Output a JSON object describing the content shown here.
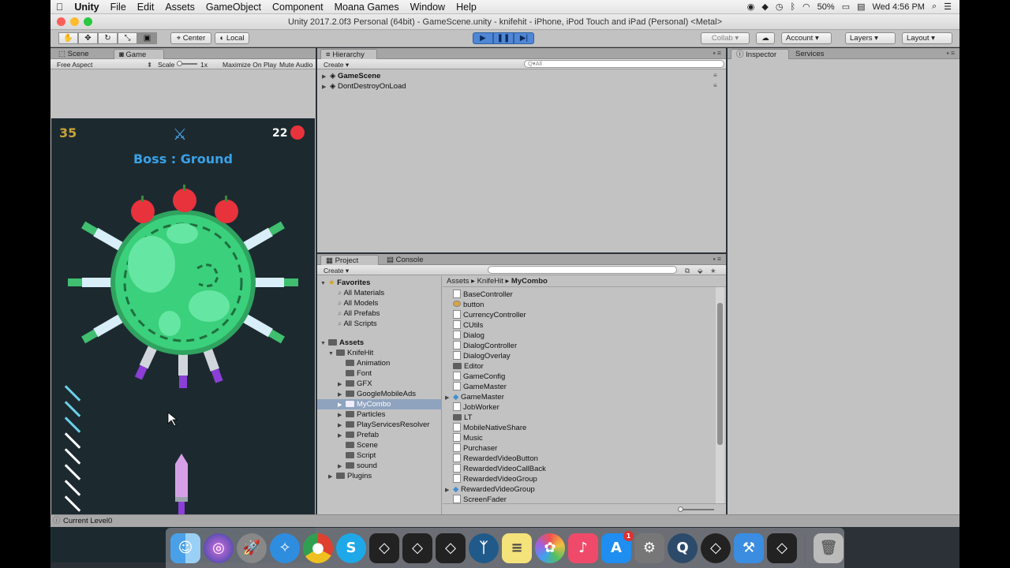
{
  "menubar": {
    "app": "Unity",
    "items": [
      "File",
      "Edit",
      "Assets",
      "GameObject",
      "Component",
      "Moana Games",
      "Window",
      "Help"
    ],
    "battery": "50%",
    "clock": "Wed 4:56 PM"
  },
  "window": {
    "title": "Unity 2017.2.0f3 Personal (64bit) - GameScene.unity - knifehit - iPhone, iPod Touch and iPad (Personal) <Metal>"
  },
  "toolbar": {
    "pivot_label": "Center",
    "space_label": "Local",
    "collab_label": "Collab ▾",
    "account_label": "Account",
    "layers_label": "Layers",
    "layout_label": "Layout"
  },
  "scene_game": {
    "tabs": [
      "Scene",
      "Game"
    ],
    "aspect": "Free Aspect",
    "scale_label": "Scale",
    "scale_value": "1x",
    "maximize_label": "Maximize On Play",
    "mute_label": "Mute Audio"
  },
  "game": {
    "score": "35",
    "apples": "22",
    "boss_title": "Boss : Ground",
    "remaining_knives": 8
  },
  "hierarchy": {
    "tab": "Hierarchy",
    "create_label": "Create",
    "search_placeholder": "Q▾All",
    "items": [
      "GameScene",
      "DontDestroyOnLoad"
    ]
  },
  "project": {
    "tabs": [
      "Project",
      "Console"
    ],
    "create_label": "Create",
    "favorites_label": "Favorites",
    "favorites": [
      "All Materials",
      "All Models",
      "All Prefabs",
      "All Scripts"
    ],
    "assets_label": "Assets",
    "knifehit_label": "KnifeHit",
    "folders": [
      "Animation",
      "Font",
      "GFX",
      "GoogleMobileAds",
      "MyCombo",
      "Particles",
      "PlayServicesResolver",
      "Prefab",
      "Scene",
      "Script",
      "sound"
    ],
    "plugins_label": "Plugins",
    "breadcrumb": [
      "Assets",
      "KnifeHit",
      "MyCombo"
    ],
    "files": [
      "BaseController",
      "button",
      "CurrencyController",
      "CUtils",
      "Dialog",
      "DialogController",
      "DialogOverlay",
      "Editor",
      "GameConfig",
      "GameMaster",
      "GameMaster",
      "JobWorker",
      "LT",
      "MobileNativeShare",
      "Music",
      "Purchaser",
      "RewardedVideoButton",
      "RewardedVideoCallBack",
      "RewardedVideoGroup",
      "RewardedVideoGroup",
      "ScreenFader"
    ]
  },
  "inspector": {
    "tabs": [
      "Inspector",
      "Services"
    ]
  },
  "status": {
    "message": "Current Level0"
  },
  "dock": {
    "apps": [
      "Finder",
      "Siri",
      "Launchpad",
      "Safari",
      "Chrome",
      "Skype",
      "Unity",
      "Unity",
      "Unity",
      "Sourcetree",
      "Notes",
      "Photos",
      "iTunes",
      "App Store",
      "System Preferences",
      "QuickTime",
      "Unity Hub",
      "Xcode",
      "Unity",
      "Trash"
    ],
    "badge": "1"
  },
  "colors": {
    "accent": "#4f87d6",
    "boss_title": "#3aa2e8",
    "score": "#c9a43a",
    "selection": "#8fa3bf"
  }
}
